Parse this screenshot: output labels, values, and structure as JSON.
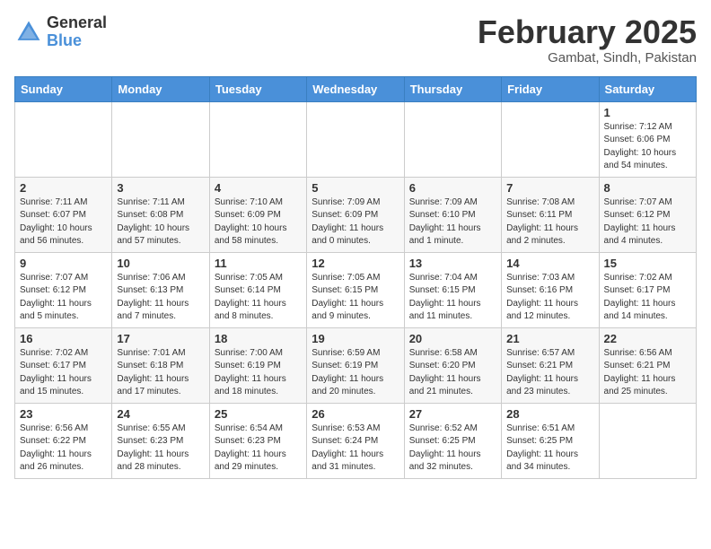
{
  "header": {
    "logo_general": "General",
    "logo_blue": "Blue",
    "month_title": "February 2025",
    "subtitle": "Gambat, Sindh, Pakistan"
  },
  "weekdays": [
    "Sunday",
    "Monday",
    "Tuesday",
    "Wednesday",
    "Thursday",
    "Friday",
    "Saturday"
  ],
  "weeks": [
    [
      {
        "day": "",
        "detail": ""
      },
      {
        "day": "",
        "detail": ""
      },
      {
        "day": "",
        "detail": ""
      },
      {
        "day": "",
        "detail": ""
      },
      {
        "day": "",
        "detail": ""
      },
      {
        "day": "",
        "detail": ""
      },
      {
        "day": "1",
        "detail": "Sunrise: 7:12 AM\nSunset: 6:06 PM\nDaylight: 10 hours\nand 54 minutes."
      }
    ],
    [
      {
        "day": "2",
        "detail": "Sunrise: 7:11 AM\nSunset: 6:07 PM\nDaylight: 10 hours\nand 56 minutes."
      },
      {
        "day": "3",
        "detail": "Sunrise: 7:11 AM\nSunset: 6:08 PM\nDaylight: 10 hours\nand 57 minutes."
      },
      {
        "day": "4",
        "detail": "Sunrise: 7:10 AM\nSunset: 6:09 PM\nDaylight: 10 hours\nand 58 minutes."
      },
      {
        "day": "5",
        "detail": "Sunrise: 7:09 AM\nSunset: 6:09 PM\nDaylight: 11 hours\nand 0 minutes."
      },
      {
        "day": "6",
        "detail": "Sunrise: 7:09 AM\nSunset: 6:10 PM\nDaylight: 11 hours\nand 1 minute."
      },
      {
        "day": "7",
        "detail": "Sunrise: 7:08 AM\nSunset: 6:11 PM\nDaylight: 11 hours\nand 2 minutes."
      },
      {
        "day": "8",
        "detail": "Sunrise: 7:07 AM\nSunset: 6:12 PM\nDaylight: 11 hours\nand 4 minutes."
      }
    ],
    [
      {
        "day": "9",
        "detail": "Sunrise: 7:07 AM\nSunset: 6:12 PM\nDaylight: 11 hours\nand 5 minutes."
      },
      {
        "day": "10",
        "detail": "Sunrise: 7:06 AM\nSunset: 6:13 PM\nDaylight: 11 hours\nand 7 minutes."
      },
      {
        "day": "11",
        "detail": "Sunrise: 7:05 AM\nSunset: 6:14 PM\nDaylight: 11 hours\nand 8 minutes."
      },
      {
        "day": "12",
        "detail": "Sunrise: 7:05 AM\nSunset: 6:15 PM\nDaylight: 11 hours\nand 9 minutes."
      },
      {
        "day": "13",
        "detail": "Sunrise: 7:04 AM\nSunset: 6:15 PM\nDaylight: 11 hours\nand 11 minutes."
      },
      {
        "day": "14",
        "detail": "Sunrise: 7:03 AM\nSunset: 6:16 PM\nDaylight: 11 hours\nand 12 minutes."
      },
      {
        "day": "15",
        "detail": "Sunrise: 7:02 AM\nSunset: 6:17 PM\nDaylight: 11 hours\nand 14 minutes."
      }
    ],
    [
      {
        "day": "16",
        "detail": "Sunrise: 7:02 AM\nSunset: 6:17 PM\nDaylight: 11 hours\nand 15 minutes."
      },
      {
        "day": "17",
        "detail": "Sunrise: 7:01 AM\nSunset: 6:18 PM\nDaylight: 11 hours\nand 17 minutes."
      },
      {
        "day": "18",
        "detail": "Sunrise: 7:00 AM\nSunset: 6:19 PM\nDaylight: 11 hours\nand 18 minutes."
      },
      {
        "day": "19",
        "detail": "Sunrise: 6:59 AM\nSunset: 6:19 PM\nDaylight: 11 hours\nand 20 minutes."
      },
      {
        "day": "20",
        "detail": "Sunrise: 6:58 AM\nSunset: 6:20 PM\nDaylight: 11 hours\nand 21 minutes."
      },
      {
        "day": "21",
        "detail": "Sunrise: 6:57 AM\nSunset: 6:21 PM\nDaylight: 11 hours\nand 23 minutes."
      },
      {
        "day": "22",
        "detail": "Sunrise: 6:56 AM\nSunset: 6:21 PM\nDaylight: 11 hours\nand 25 minutes."
      }
    ],
    [
      {
        "day": "23",
        "detail": "Sunrise: 6:56 AM\nSunset: 6:22 PM\nDaylight: 11 hours\nand 26 minutes."
      },
      {
        "day": "24",
        "detail": "Sunrise: 6:55 AM\nSunset: 6:23 PM\nDaylight: 11 hours\nand 28 minutes."
      },
      {
        "day": "25",
        "detail": "Sunrise: 6:54 AM\nSunset: 6:23 PM\nDaylight: 11 hours\nand 29 minutes."
      },
      {
        "day": "26",
        "detail": "Sunrise: 6:53 AM\nSunset: 6:24 PM\nDaylight: 11 hours\nand 31 minutes."
      },
      {
        "day": "27",
        "detail": "Sunrise: 6:52 AM\nSunset: 6:25 PM\nDaylight: 11 hours\nand 32 minutes."
      },
      {
        "day": "28",
        "detail": "Sunrise: 6:51 AM\nSunset: 6:25 PM\nDaylight: 11 hours\nand 34 minutes."
      },
      {
        "day": "",
        "detail": ""
      }
    ]
  ]
}
